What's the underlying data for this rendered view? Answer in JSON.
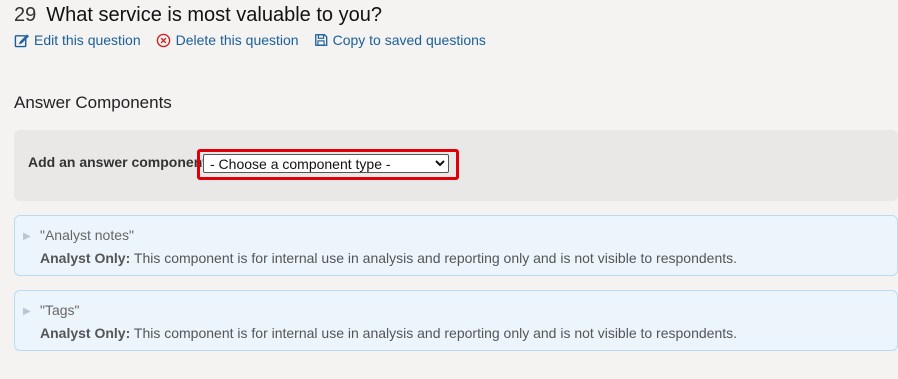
{
  "question": {
    "number": "29",
    "title": "What service is most valuable to you?"
  },
  "actions": {
    "edit_label": "Edit this question",
    "delete_label": "Delete this question",
    "copy_label": "Copy to saved questions"
  },
  "colors": {
    "link": "#1a5f99",
    "delete_icon": "#d02424",
    "highlight": "#e0000a",
    "card_bg": "#ecf5fc",
    "card_border": "#b9dcf2"
  },
  "answer_components": {
    "section_title": "Answer Components",
    "add_label": "Add an answer component:",
    "select_value": "- Choose a component type -"
  },
  "components": [
    {
      "name": "\"Analyst notes\"",
      "prefix": "Analyst Only:",
      "description": "This component is for internal use in analysis and reporting only and is not visible to respondents."
    },
    {
      "name": "\"Tags\"",
      "prefix": "Analyst Only:",
      "description": "This component is for internal use in analysis and reporting only and is not visible to respondents."
    }
  ],
  "icons": {
    "edit": "edit-icon",
    "delete": "delete-circle-x-icon",
    "copy": "save-icon",
    "caret": "caret-right-icon"
  }
}
